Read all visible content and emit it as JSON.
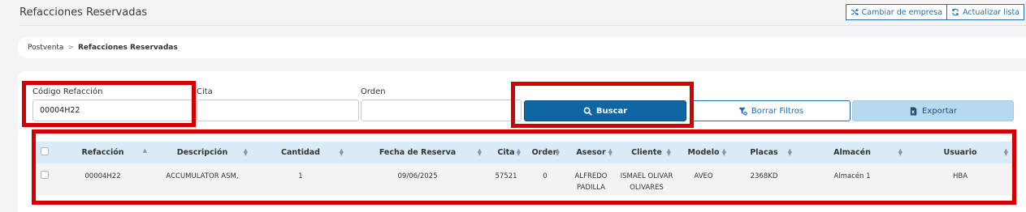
{
  "header": {
    "title": "Refacciones Reservadas",
    "change_company_label": "Cambiar de empresa",
    "refresh_list_label": "Actualizar lista"
  },
  "breadcrumb": {
    "parent": "Postventa",
    "separator": ">",
    "current": "Refacciones Reservadas"
  },
  "filters": {
    "codigo": {
      "label": "Código Refacción",
      "value": "00004H22"
    },
    "cita": {
      "label": "Cita",
      "value": ""
    },
    "orden": {
      "label": "Orden",
      "value": ""
    }
  },
  "buttons": {
    "search": "Buscar",
    "clear_filters": "Borrar Filtros",
    "export": "Exportar"
  },
  "table": {
    "columns": [
      "Refacción",
      "Descripción",
      "Cantidad",
      "Fecha de Reserva",
      "Cita",
      "Orden",
      "Asesor",
      "Cliente",
      "Modelo",
      "Placas",
      "Almacén",
      "Usuario"
    ],
    "rows": [
      {
        "refaccion": "00004H22",
        "descripcion": "ACCUMULATOR ASM,",
        "cantidad": "1",
        "fecha": "09/06/2025",
        "cita": "57521",
        "orden": "0",
        "asesor_1": "ALFREDO",
        "asesor_2": "PADILLA",
        "cliente_1": "ISMAEL OLIVAR",
        "cliente_2": "OLIVARES",
        "modelo": "AVEO",
        "placas": "2368KD",
        "almacen": "Almacén 1",
        "usuario": "HBA"
      }
    ]
  },
  "colors": {
    "primary": "#0f66a3",
    "highlight": "#d40000",
    "table_header": "#d9ebf6"
  }
}
